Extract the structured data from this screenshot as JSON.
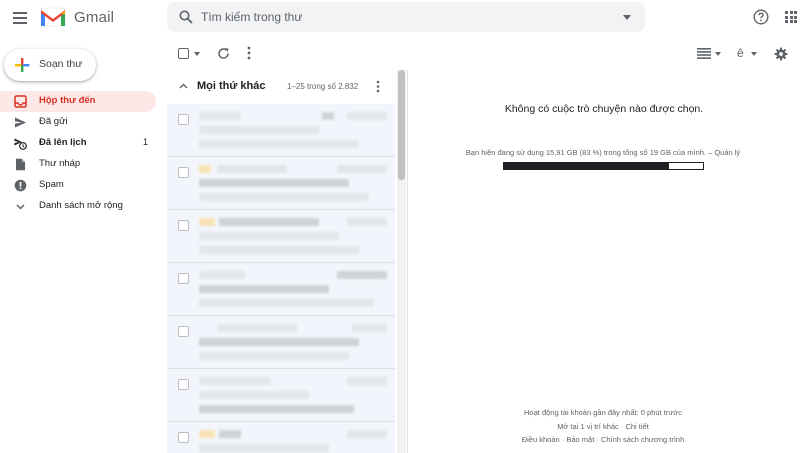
{
  "header": {
    "app_name": "Gmail",
    "search_placeholder": "Tìm kiếm trong thư",
    "icons": [
      "menu-icon",
      "gmail-logo",
      "search-icon",
      "search-options-icon",
      "help-icon",
      "apps-icon"
    ]
  },
  "sidebar": {
    "compose_label": "Soạn thư",
    "items": [
      {
        "label": "Hộp thư đến",
        "icon": "inbox-icon",
        "active": true
      },
      {
        "label": "Đã gửi",
        "icon": "send-icon"
      },
      {
        "label": "Đã lên lịch",
        "icon": "scheduled-icon",
        "count": "1",
        "bold": true
      },
      {
        "label": "Thư nháp",
        "icon": "draft-icon"
      },
      {
        "label": "Spam",
        "icon": "spam-icon"
      },
      {
        "label": "Danh sách mở rộng",
        "icon": "chevron-down-icon"
      }
    ]
  },
  "toolbar": {
    "lang_label": "ê"
  },
  "mail_list": {
    "section_title": "Mọi thứ khác",
    "range": "1–25 trong số 2.832"
  },
  "reading_pane": {
    "no_conversation": "Không có cuộc trò chuyện nào được chọn.",
    "storage_text": "Bạn hiện đang sử dụng 15,91 GB (83 %) trong tổng số 19 GB của mình.",
    "storage_sep": " – ",
    "manage_label": "Quản lý",
    "storage_percent": 83,
    "last_activity": "Hoạt động tài khoản gần đây nhất: 0 phút trước",
    "open_location": "Mở tại 1 vị trí khác",
    "dot": " · ",
    "details": "Chi tiết",
    "terms": "Điều khoản",
    "privacy": "Bảo mật",
    "program_policy": "Chính sách chương trình"
  },
  "colors": {
    "accent_red": "#d93025",
    "active_bg": "#fce8e6",
    "row_bg": "#f2f6fc",
    "icon_grey": "#5f6368"
  }
}
